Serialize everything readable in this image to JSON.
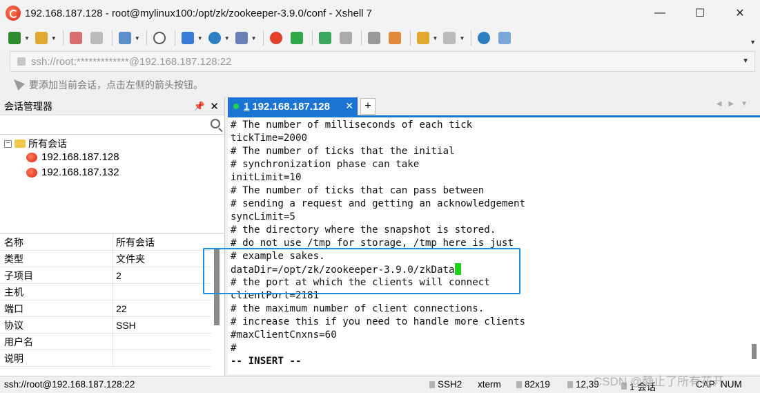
{
  "window": {
    "title": "192.168.187.128 - root@mylinux100:/opt/zk/zookeeper-3.9.0/conf - Xshell 7",
    "minimize": "—",
    "maximize": "☐",
    "close": "✕"
  },
  "toolbar": {
    "icons": [
      "new-session-icon",
      "open-folder-icon",
      "disconnect-icon",
      "reconnect-icon",
      "properties-icon",
      "find-icon",
      "transfer-icon",
      "globe-icon",
      "font-icon",
      "xshell-icon",
      "xftp-icon",
      "fullscreen-icon",
      "lock-icon",
      "keyboard-icon",
      "highlight-icon",
      "compose-icon",
      "layout-icon",
      "help-icon",
      "chat-icon"
    ]
  },
  "address_bar": {
    "value": "ssh://root:*************@192.168.187.128:22"
  },
  "tip_bar": {
    "text": "要添加当前会话，点击左侧的箭头按钮。"
  },
  "session_manager": {
    "title": "会话管理器",
    "pin": "📌",
    "close": "✕",
    "tree": {
      "root_label": "所有会话",
      "toggle": "−",
      "items": [
        "192.168.187.128",
        "192.168.187.132"
      ]
    },
    "properties": [
      {
        "key": "名称",
        "value": "所有会话"
      },
      {
        "key": "类型",
        "value": "文件夹"
      },
      {
        "key": "子项目",
        "value": "2"
      },
      {
        "key": "主机",
        "value": ""
      },
      {
        "key": "端口",
        "value": "22"
      },
      {
        "key": "协议",
        "value": "SSH"
      },
      {
        "key": "用户名",
        "value": ""
      },
      {
        "key": "说明",
        "value": ""
      }
    ]
  },
  "tabs": [
    {
      "number": "1",
      "label": "192.168.187.128",
      "close": "✕"
    }
  ],
  "tab_add": "+",
  "terminal": {
    "lines": [
      "# The number of milliseconds of each tick",
      "tickTime=2000",
      "# The number of ticks that the initial",
      "# synchronization phase can take",
      "initLimit=10",
      "# The number of ticks that can pass between",
      "# sending a request and getting an acknowledgement",
      "syncLimit=5",
      "# the directory where the snapshot is stored.",
      "# do not use /tmp for storage, /tmp here is just",
      "# example sakes.",
      "dataDir=/opt/zk/zookeeper-3.9.0/zkData",
      "# the port at which the clients will connect",
      "clientPort=2181",
      "# the maximum number of client connections.",
      "# increase this if you need to handle more clients",
      "#maxClientCnxns=60",
      "#",
      "-- INSERT --"
    ],
    "cursor_line": 11,
    "cursor_color": "#19d219"
  },
  "status_bar": {
    "connection": "ssh://root@192.168.187.128:22",
    "protocol": "SSH2",
    "terminal_type": "xterm",
    "size": "82x19",
    "position": "12,39",
    "sessions": "1 会话",
    "caps": "CAP",
    "num": "NUM"
  },
  "watermark": "CSDN @静止了所有花开",
  "colors": {
    "accent": "#1c75d2",
    "highlight_border": "#1a8ee0"
  }
}
